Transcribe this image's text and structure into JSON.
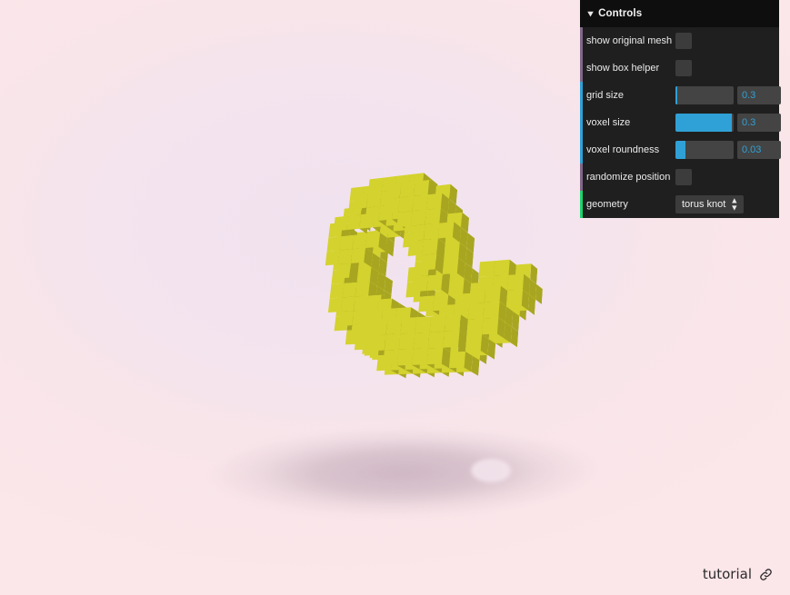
{
  "app": {
    "background_color": "#f4e4ec",
    "shadow_color": "#9a7c93"
  },
  "scene": {
    "name": "voxelized-torus-knot",
    "voxel_color": "#d9d732",
    "voxel_top_color": "#e3e03a",
    "voxel_side_color": "#a8a620"
  },
  "gui": {
    "title": "Controls",
    "collapse_icon": "chevron-down-icon",
    "accent_number_color": "#2fa1d6",
    "rows": [
      {
        "label": "show original mesh",
        "type": "checkbox",
        "checked": false,
        "name": "show-original-mesh"
      },
      {
        "label": "show box helper",
        "type": "checkbox",
        "checked": false,
        "name": "show-box-helper"
      },
      {
        "label": "grid size",
        "type": "slider",
        "value": "0.3",
        "fill_percent": 3,
        "name": "grid-size"
      },
      {
        "label": "voxel size",
        "type": "slider",
        "value": "0.3",
        "fill_percent": 97,
        "name": "voxel-size"
      },
      {
        "label": "voxel roundness",
        "type": "slider",
        "value": "0.03",
        "fill_percent": 17,
        "name": "voxel-roundness"
      },
      {
        "label": "randomize position",
        "type": "checkbox",
        "checked": false,
        "name": "randomize-position"
      },
      {
        "label": "geometry",
        "type": "select",
        "value": "torus knot",
        "name": "geometry"
      }
    ]
  },
  "footer": {
    "link_label": "tutorial",
    "link_icon": "link-chain-icon"
  }
}
